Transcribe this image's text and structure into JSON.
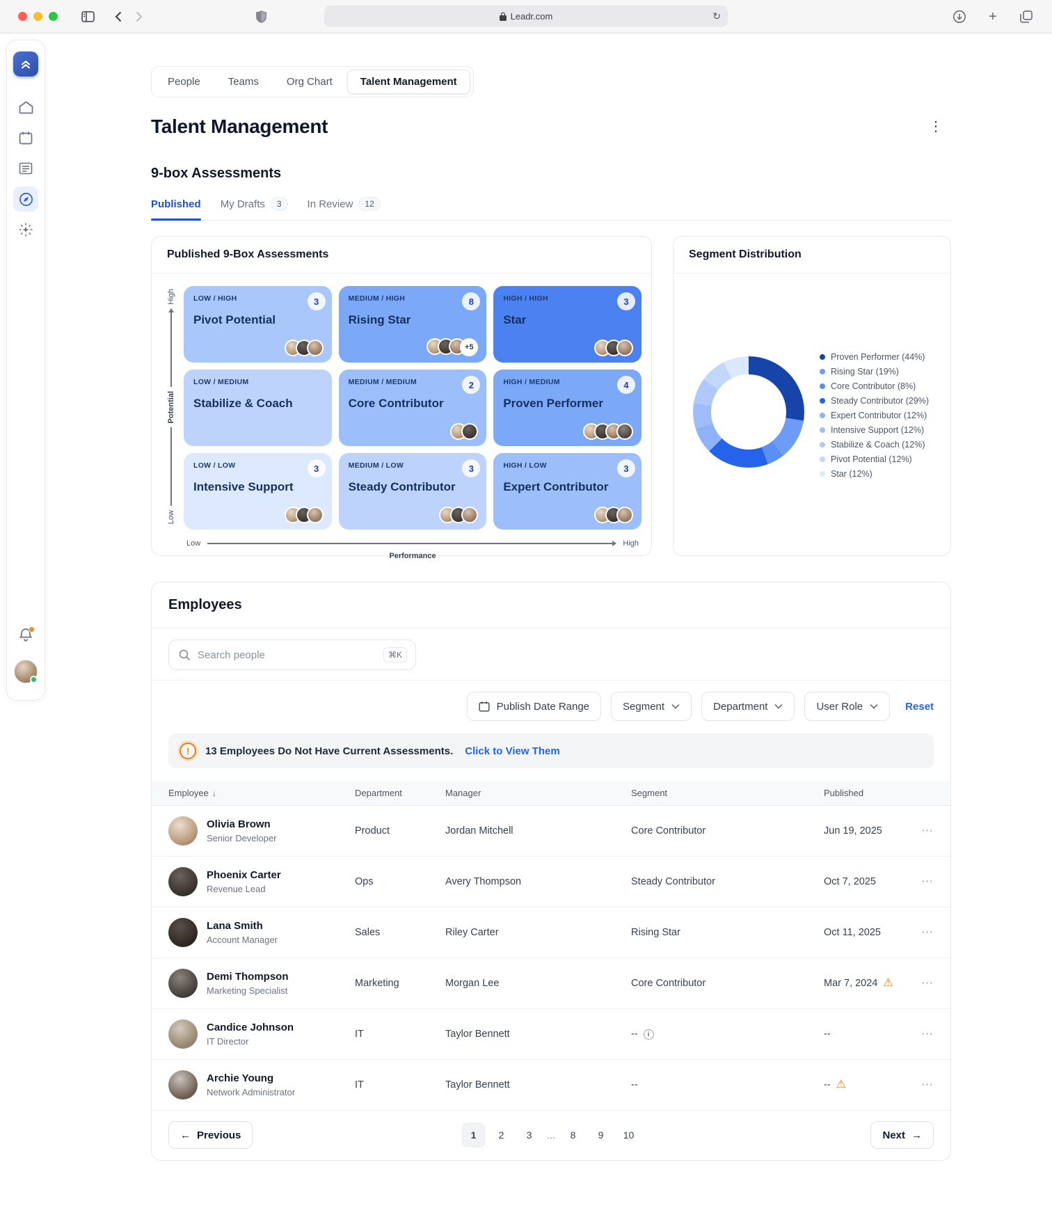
{
  "colors": {
    "accent": "#2563eb",
    "warning_orange": "#e87f1f",
    "active_nav_blue": "#2f5fd7",
    "traffic_lights": [
      "#ff5f57",
      "#febc2e",
      "#28c840"
    ]
  },
  "icons": {
    "kebab": "⋮",
    "ellipsis": "⋯",
    "warning": "⚠",
    "arrow_left": "←",
    "arrow_right": "→",
    "plus": "+",
    "reload": "↻",
    "info": "i",
    "alert": "!"
  },
  "browser": {
    "url": "Leadr.com"
  },
  "nav_tabs": {
    "items": [
      {
        "label": "People",
        "active": false
      },
      {
        "label": "Teams",
        "active": false
      },
      {
        "label": "Org Chart",
        "active": false
      },
      {
        "label": "Talent Management",
        "active": true
      }
    ]
  },
  "page": {
    "title": "Talent Management"
  },
  "section": {
    "title": "9-box Assessments",
    "tabs": [
      {
        "label": "Published",
        "badge": "",
        "active": true
      },
      {
        "label": "My Drafts",
        "badge": "3",
        "active": false
      },
      {
        "label": "In Review",
        "badge": "12",
        "active": false
      }
    ]
  },
  "nine_box": {
    "title": "Published 9-Box Assessments",
    "y_axis": "Potential",
    "y_high": "High",
    "y_low": "Low",
    "x_axis": "Performance",
    "x_low": "Low",
    "x_high": "High",
    "boxes": [
      {
        "tier": "LOW / HIGH",
        "name": "Pivot Potential",
        "count": "3",
        "avatars": 3,
        "extra": "",
        "color": "#a9c7fb"
      },
      {
        "tier": "MEDIUM / HIGH",
        "name": "Rising Star",
        "count": "8",
        "avatars": 3,
        "extra": "+5",
        "color": "#7ca8f8"
      },
      {
        "tier": "HIGH / HIGH",
        "name": "Star",
        "count": "3",
        "avatars": 3,
        "extra": "",
        "color": "#4c81f1"
      },
      {
        "tier": "LOW / MEDIUM",
        "name": "Stabilize & Coach",
        "count": "",
        "avatars": 0,
        "extra": "",
        "color": "#bdd3fc"
      },
      {
        "tier": "MEDIUM / MEDIUM",
        "name": "Core Contributor",
        "count": "2",
        "avatars": 2,
        "extra": "",
        "color": "#9cbefa"
      },
      {
        "tier": "HIGH / MEDIUM",
        "name": "Proven Performer",
        "count": "4",
        "avatars": 4,
        "extra": "",
        "color": "#7ca8f8"
      },
      {
        "tier": "LOW / LOW",
        "name": "Intensive Support",
        "count": "3",
        "avatars": 3,
        "extra": "",
        "color": "#dde9fe"
      },
      {
        "tier": "MEDIUM / LOW",
        "name": "Steady Contributor",
        "count": "3",
        "avatars": 3,
        "extra": "",
        "color": "#bdd3fc"
      },
      {
        "tier": "HIGH / LOW",
        "name": "Expert Contributor",
        "count": "3",
        "avatars": 3,
        "extra": "",
        "color": "#9cbefa"
      }
    ]
  },
  "segment": {
    "title": "Segment Distribution",
    "legend": [
      {
        "label": "Proven Performer (44%)",
        "value": 44,
        "color": "#1644a8"
      },
      {
        "label": "Rising Star (19%)",
        "value": 19,
        "color": "#6d9cf6"
      },
      {
        "label": "Core Contributor (8%)",
        "value": 8,
        "color": "#5a90f4"
      },
      {
        "label": "Steady Contributor (29%)",
        "value": 29,
        "color": "#2563eb"
      },
      {
        "label": "Expert Contributor (12%)",
        "value": 12,
        "color": "#8fb3f8"
      },
      {
        "label": "Intensive Support (12%)",
        "value": 12,
        "color": "#9fbef9"
      },
      {
        "label": "Stabilize & Coach (12%)",
        "value": 12,
        "color": "#b1c9fa"
      },
      {
        "label": "Pivot Potential (12%)",
        "value": 12,
        "color": "#c3d6fc"
      },
      {
        "label": "Star (12%)",
        "value": 12,
        "color": "#dce8fe"
      }
    ]
  },
  "chart_data": {
    "type": "pie",
    "title": "Segment Distribution",
    "labels": [
      "Proven Performer",
      "Rising Star",
      "Core Contributor",
      "Steady Contributor",
      "Expert Contributor",
      "Intensive Support",
      "Stabilize & Coach",
      "Pivot Potential",
      "Star"
    ],
    "values": [
      44,
      19,
      8,
      29,
      12,
      12,
      12,
      12,
      12
    ],
    "unit": "%",
    "donut": true,
    "legend_position": "right"
  },
  "employees": {
    "title": "Employees",
    "search_placeholder": "Search people",
    "shortcut": "⌘K",
    "filters": [
      {
        "label": "Publish Date Range"
      },
      {
        "label": "Segment"
      },
      {
        "label": "Department"
      },
      {
        "label": "User Role"
      }
    ],
    "reset_label": "Reset",
    "banner": {
      "text": "13 Employees Do Not Have Current Assessments.",
      "link": "Click to View Them"
    },
    "table": {
      "headers": [
        "Employee",
        "Department",
        "Manager",
        "Segment",
        "Published"
      ],
      "rows": [
        {
          "name": "Olivia Brown",
          "role": "Senior Developer",
          "department": "Product",
          "manager": "Jordan Mitchell",
          "segment": "Core Contributor",
          "segment_info": false,
          "published": "Jun 19, 2025",
          "published_warning": false
        },
        {
          "name": "Phoenix Carter",
          "role": "Revenue Lead",
          "department": "Ops",
          "manager": "Avery Thompson",
          "segment": "Steady Contributor",
          "segment_info": false,
          "published": "Oct 7, 2025",
          "published_warning": false
        },
        {
          "name": "Lana Smith",
          "role": "Account Manager",
          "department": "Sales",
          "manager": "Riley Carter",
          "segment": "Rising Star",
          "segment_info": false,
          "published": "Oct 11, 2025",
          "published_warning": false
        },
        {
          "name": "Demi Thompson",
          "role": "Marketing Specialist",
          "department": "Marketing",
          "manager": "Morgan Lee",
          "segment": "Core Contributor",
          "segment_info": false,
          "published": "Mar 7, 2024",
          "published_warning": true
        },
        {
          "name": "Candice Johnson",
          "role": "IT Director",
          "department": "IT",
          "manager": "Taylor Bennett",
          "segment": "--",
          "segment_info": true,
          "published": "--",
          "published_warning": false
        },
        {
          "name": "Archie Young",
          "role": "Network Administrator",
          "department": "IT",
          "manager": "Taylor Bennett",
          "segment": "--",
          "segment_info": false,
          "published": "--",
          "published_warning": true
        }
      ]
    },
    "pagination": {
      "prev": "Previous",
      "pages": [
        "1",
        "2",
        "3",
        "…",
        "8",
        "9",
        "10"
      ],
      "active_page": "1",
      "next": "Next"
    }
  }
}
